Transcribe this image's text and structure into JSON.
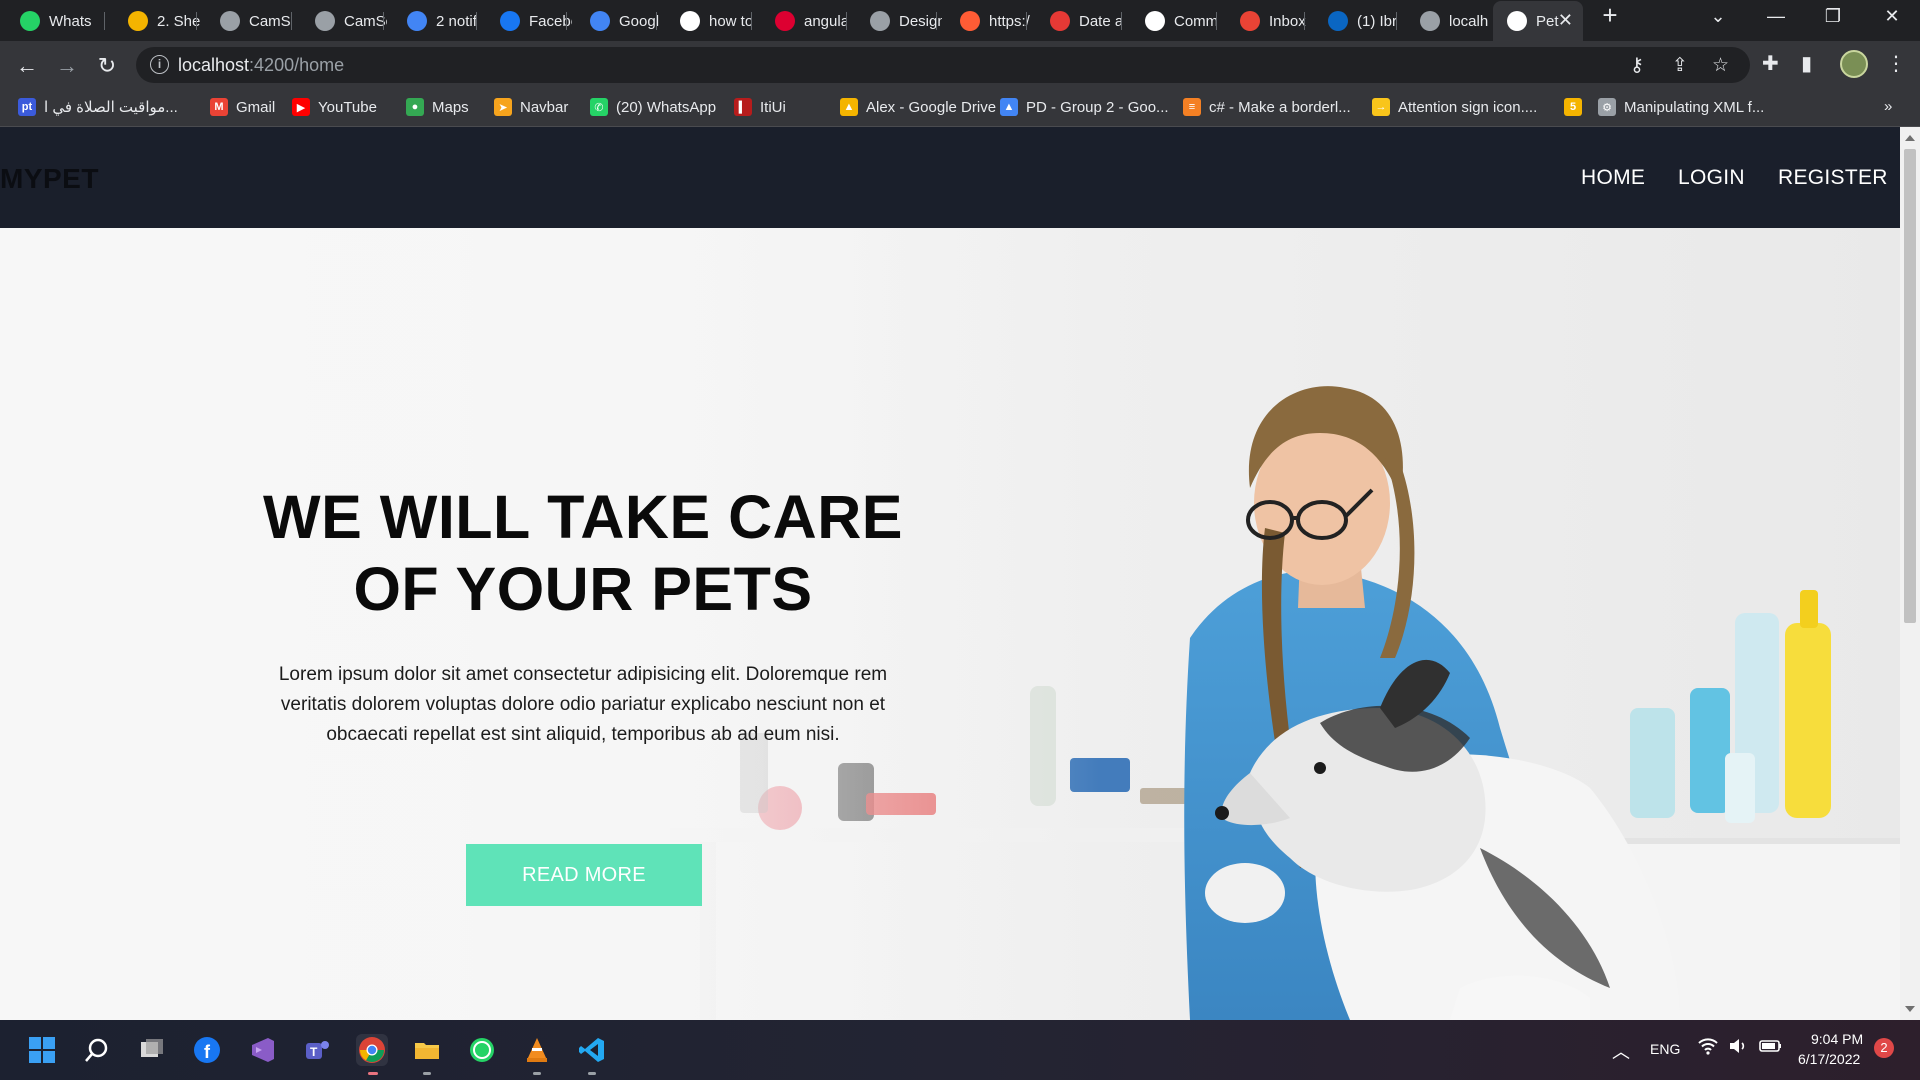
{
  "browser": {
    "tabs": [
      {
        "title": "Whats",
        "icon": "whatsapp-icon",
        "color": "#25d366"
      },
      {
        "title": "2. She",
        "icon": "google-drive-icon",
        "color": "#f4b400"
      },
      {
        "title": "CamSc",
        "icon": "globe-icon",
        "color": "#9aa0a6"
      },
      {
        "title": "CamSc",
        "icon": "globe-icon",
        "color": "#9aa0a6"
      },
      {
        "title": "2 notif",
        "icon": "notification-badge-icon",
        "color": "#4285f4"
      },
      {
        "title": "Facebo",
        "icon": "facebook-icon",
        "color": "#1877f2"
      },
      {
        "title": "Googl",
        "icon": "google-translate-icon",
        "color": "#4285f4"
      },
      {
        "title": "how to",
        "icon": "google-icon",
        "color": "#ffffff"
      },
      {
        "title": "angula",
        "icon": "angular-docs-icon",
        "color": "#dd0031"
      },
      {
        "title": "Design",
        "icon": "home-outline-icon",
        "color": "#9aa0a6"
      },
      {
        "title": "https:/",
        "icon": "pen-icon",
        "color": "#ff5c35"
      },
      {
        "title": "Date a",
        "icon": "fork-icon",
        "color": "#e53935"
      },
      {
        "title": "Comm",
        "icon": "github-icon",
        "color": "#ffffff"
      },
      {
        "title": "Inbox",
        "icon": "gmail-icon",
        "color": "#ea4335"
      },
      {
        "title": "(1) Ibr",
        "icon": "linkedin-icon",
        "color": "#0a66c2"
      },
      {
        "title": "localh",
        "icon": "globe-icon",
        "color": "#9aa0a6"
      },
      {
        "title": "Pet",
        "icon": "angular-icon",
        "color": "#ffffff"
      }
    ],
    "url_host": "localhost",
    "url_path": ":4200/home",
    "bookmarks": [
      {
        "label": "مواقيت الصلاة في ا...",
        "icon": "prayer-times-icon",
        "color": "#3b5bdb",
        "glyph": "pt"
      },
      {
        "label": "Gmail",
        "icon": "gmail-icon",
        "color": "#ea4335",
        "glyph": "M"
      },
      {
        "label": "YouTube",
        "icon": "youtube-icon",
        "color": "#ff0000",
        "glyph": "▶"
      },
      {
        "label": "Maps",
        "icon": "maps-pin-icon",
        "color": "#34a853",
        "glyph": "●"
      },
      {
        "label": "Navbar",
        "icon": "navbar-bookmark-icon",
        "color": "#f7a41d",
        "glyph": "➤"
      },
      {
        "label": "(20) WhatsApp",
        "icon": "whatsapp-icon",
        "color": "#25d366",
        "glyph": "✆"
      },
      {
        "label": "ItiUi",
        "icon": "itiui-icon",
        "color": "#b71c1c",
        "glyph": "▍"
      },
      {
        "label": "Alex - Google Drive",
        "icon": "google-drive-icon",
        "color": "#f4b400",
        "glyph": "▲"
      },
      {
        "label": "PD - Group 2 - Goo...",
        "icon": "google-drive-icon",
        "color": "#4285f4",
        "glyph": "▲"
      },
      {
        "label": "c# - Make a borderl...",
        "icon": "stackoverflow-icon",
        "color": "#f48024",
        "glyph": "≡"
      },
      {
        "label": "Attention sign icon....",
        "icon": "arrow-bookmark-icon",
        "color": "#f9c51b",
        "glyph": "→"
      },
      {
        "label": "",
        "icon": "number-five-icon",
        "color": "#f5b400",
        "glyph": "5"
      },
      {
        "label": "Manipulating XML f...",
        "icon": "xml-tool-icon",
        "color": "#9aa0a6",
        "glyph": "⚙"
      }
    ],
    "bookmarks_overflow": "»"
  },
  "site": {
    "brand": "MYPET",
    "nav": {
      "home": "HOME",
      "login": "LOGIN",
      "register": "REGISTER"
    },
    "hero": {
      "title_line1": "WE WILL TAKE CARE",
      "title_line2": "OF YOUR PETS",
      "text": "Lorem ipsum dolor sit amet consectetur adipisicing elit. Doloremque rem veritatis dolorem voluptas dolore odio pariatur explicabo nesciunt non et obcaecati repellat est sint aliquid, temporibus ab ad eum nisi.",
      "button": "READ MORE"
    },
    "colors": {
      "nav_bg": "#1a1f2b",
      "button": "#5fe3b8",
      "brand_text": "#0b0d12"
    }
  },
  "taskbar": {
    "apps": [
      "windows-start-icon",
      "search-icon",
      "task-view-icon",
      "facebook-icon",
      "visual-studio-icon",
      "teams-icon",
      "chrome-icon",
      "file-explorer-icon",
      "whatsapp-icon",
      "vlc-icon",
      "vscode-icon"
    ],
    "language": "ENG",
    "time": "9:04 PM",
    "date": "6/17/2022",
    "notifications": "2"
  }
}
